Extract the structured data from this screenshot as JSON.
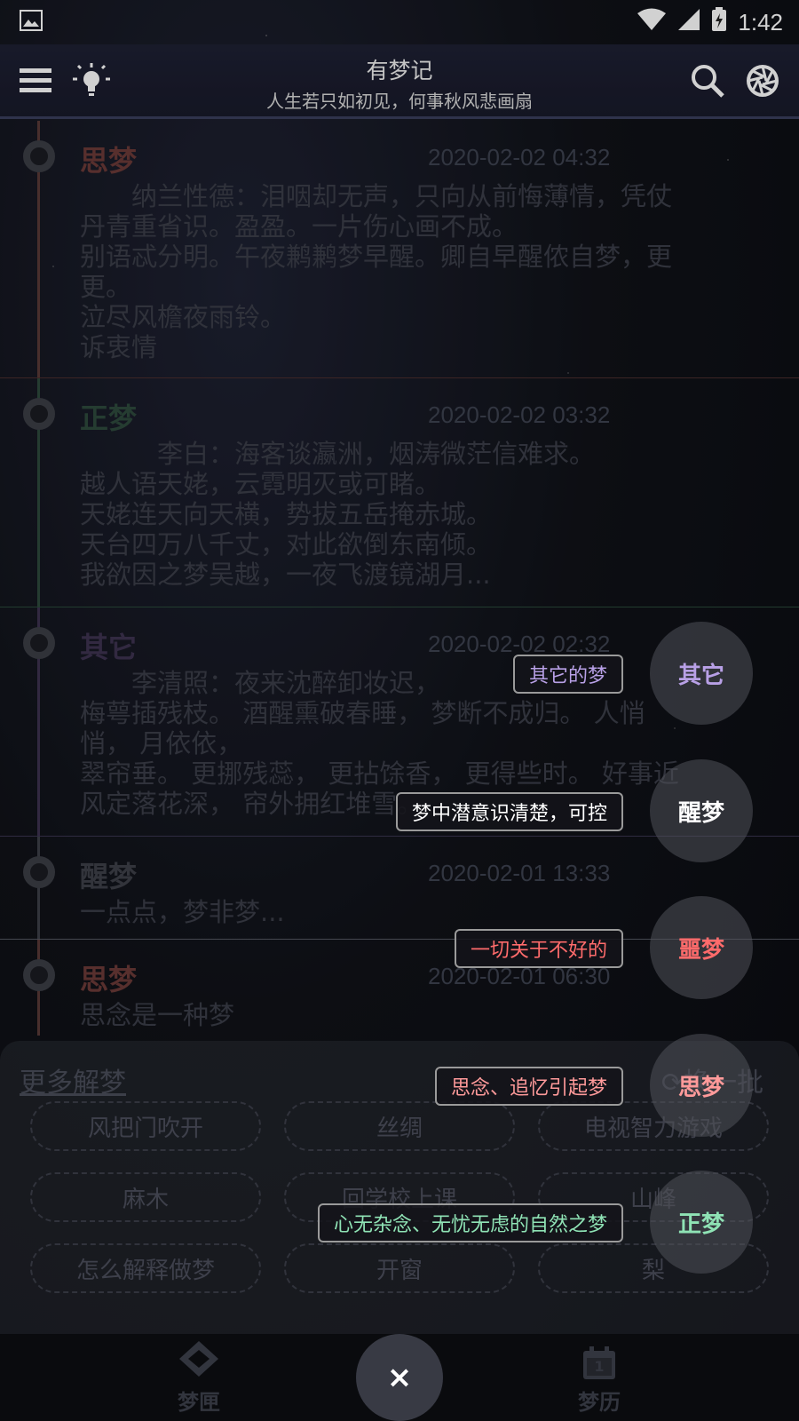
{
  "status_bar": {
    "time": "1:42"
  },
  "header": {
    "title": "有梦记",
    "subtitle": "人生若只如初见，何事秋风悲画扇"
  },
  "entries": [
    {
      "category": "思梦",
      "color": "#6b3a38",
      "date": "2020-02-02 04:32",
      "lines": [
        "　　纳兰性德：泪咽却无声，只向从前悔薄情，凭仗",
        "丹青重省识。盈盈。一片伤心画不成。",
        "别语忒分明。午夜鹣鹣梦早醒。卿自早醒侬自梦，更",
        "更。",
        "泣尽风檐夜雨铃。",
        "诉衷情"
      ]
    },
    {
      "category": "正梦",
      "color": "#2e4a3c",
      "date": "2020-02-02 03:32",
      "lines": [
        "　　　李白：海客谈瀛洲，烟涛微茫信难求。",
        "越人语天姥，云霓明灭或可睹。",
        "天姥连天向天横，势拔五岳掩赤城。",
        "天台四万八千丈，对此欲倒东南倾。",
        "我欲因之梦吴越，一夜飞渡镜湖月..."
      ]
    },
    {
      "category": "其它",
      "color": "#3d3350",
      "date": "2020-02-02 02:32",
      "lines": [
        "　　李清照：夜来沈醉卸妆迟，",
        "梅萼插残枝。 酒醒熏破春睡， 梦断不成归。 人悄",
        "悄， 月依依，",
        "翠帘垂。 更挪残蕊， 更拈馀香， 更得些时。 好事近",
        "风定落花深， 帘外拥红堆雪。"
      ]
    },
    {
      "category": "醒梦",
      "color": "#3e4048",
      "date": "2020-02-01 13:33",
      "lines": [
        "一点点，梦非梦..."
      ]
    },
    {
      "category": "思梦",
      "color": "#6b3a38",
      "date": "2020-02-01 06:30",
      "lines": [
        "思念是一种梦"
      ]
    }
  ],
  "sheet": {
    "more_label": "更多解梦",
    "refresh_label": "换一批",
    "chips": [
      "风把门吹开",
      "丝绸",
      "电视智力游戏",
      "麻木",
      "回学校上课",
      "山峰",
      "怎么解释做梦",
      "开窗",
      "梨"
    ]
  },
  "nav": {
    "left_label": "梦匣",
    "right_label": "梦历",
    "calendar_day": "1",
    "close_symbol": "×"
  },
  "speed_dial": [
    {
      "fab_label": "其它",
      "hint": "其它的梦",
      "color": "#b8a0e6"
    },
    {
      "fab_label": "醒梦",
      "hint": "梦中潜意识清楚，可控",
      "color": "#ffffff"
    },
    {
      "fab_label": "噩梦",
      "hint": "一切关于不好的",
      "color": "#ff6b6b"
    },
    {
      "fab_label": "思梦",
      "hint": "思念、追忆引起梦",
      "color": "#ff9a9a"
    },
    {
      "fab_label": "正梦",
      "hint": "心无杂念、无忧无虑的自然之梦",
      "color": "#8fe3b5"
    }
  ]
}
